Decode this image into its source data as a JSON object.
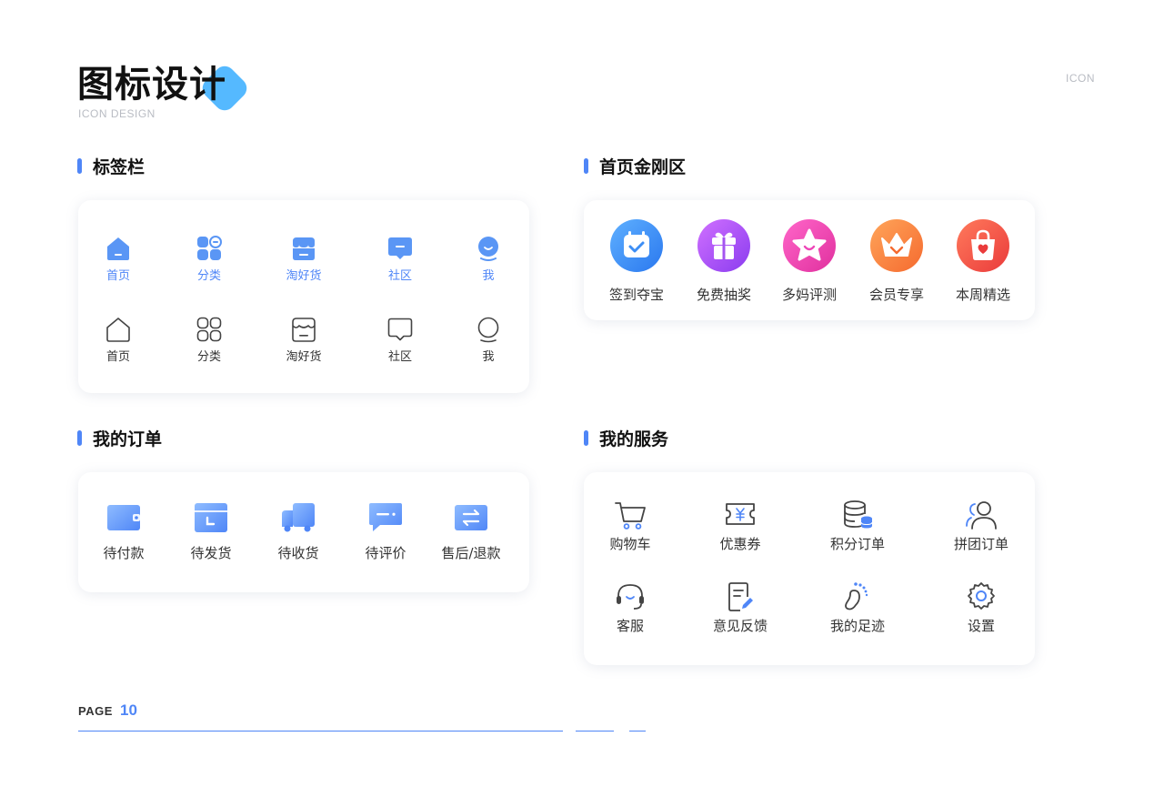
{
  "header": {
    "title": "图标设计",
    "subtitle": "ICON DESIGN",
    "corner_label": "ICON"
  },
  "colors": {
    "accent": "#4f86f7",
    "tab_active": "#5a96f5",
    "tab_inactive": "#444444",
    "text": "#222222",
    "muted": "#b9bcc3"
  },
  "tab_bar": {
    "title": "标签栏",
    "active_row": [
      {
        "label": "首页",
        "icon": "home-icon"
      },
      {
        "label": "分类",
        "icon": "category-icon"
      },
      {
        "label": "淘好货",
        "icon": "store-icon"
      },
      {
        "label": "社区",
        "icon": "community-icon"
      },
      {
        "label": "我",
        "icon": "profile-icon"
      }
    ],
    "inactive_row": [
      {
        "label": "首页",
        "icon": "home-icon"
      },
      {
        "label": "分类",
        "icon": "category-icon"
      },
      {
        "label": "淘好货",
        "icon": "store-icon"
      },
      {
        "label": "社区",
        "icon": "community-icon"
      },
      {
        "label": "我",
        "icon": "profile-icon"
      }
    ]
  },
  "home_grid": {
    "title": "首页金刚区",
    "items": [
      {
        "label": "签到夺宝",
        "icon": "calendar-check-icon",
        "color": "#3d8ef5"
      },
      {
        "label": "免费抽奖",
        "icon": "gift-icon",
        "color": "#a455f0"
      },
      {
        "label": "多妈评测",
        "icon": "star-icon",
        "color": "#ee46b8"
      },
      {
        "label": "会员专享",
        "icon": "crown-icon",
        "color": "#fb8a45"
      },
      {
        "label": "本周精选",
        "icon": "shopping-bag-icon",
        "color": "#f3574a"
      }
    ]
  },
  "my_orders": {
    "title": "我的订单",
    "items": [
      {
        "label": "待付款",
        "icon": "wallet-icon"
      },
      {
        "label": "待发货",
        "icon": "package-icon"
      },
      {
        "label": "待收货",
        "icon": "truck-icon"
      },
      {
        "label": "待评价",
        "icon": "comment-icon"
      },
      {
        "label": "售后/退款",
        "icon": "exchange-icon"
      }
    ]
  },
  "my_services": {
    "title": "我的服务",
    "row1": [
      {
        "label": "购物车",
        "icon": "cart-icon"
      },
      {
        "label": "优惠券",
        "icon": "coupon-icon"
      },
      {
        "label": "积分订单",
        "icon": "points-icon"
      },
      {
        "label": "拼团订单",
        "icon": "group-icon"
      }
    ],
    "row2": [
      {
        "label": "客服",
        "icon": "headset-icon"
      },
      {
        "label": "意见反馈",
        "icon": "feedback-icon"
      },
      {
        "label": "我的足迹",
        "icon": "footprint-icon"
      },
      {
        "label": "设置",
        "icon": "settings-icon"
      }
    ]
  },
  "footer": {
    "page_label": "PAGE",
    "page_number": "10"
  }
}
